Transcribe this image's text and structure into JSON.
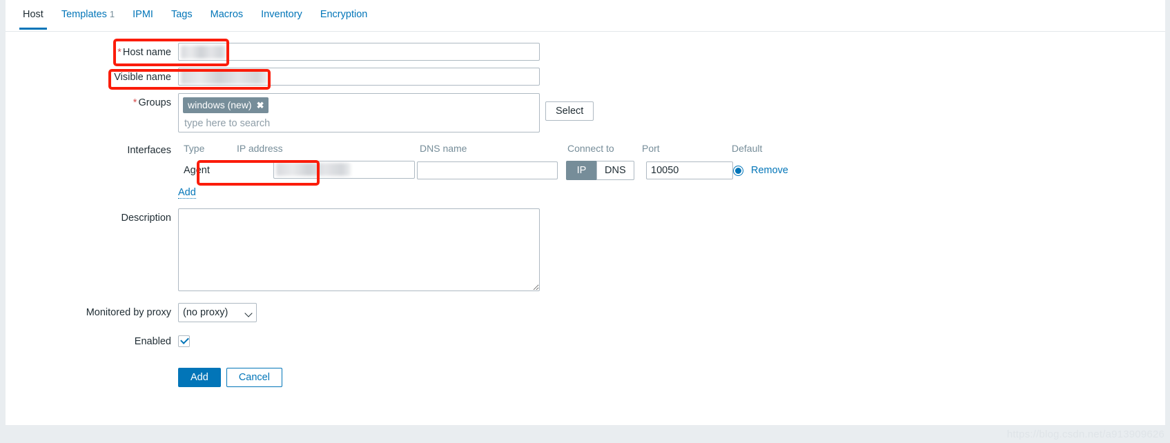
{
  "window": {
    "background_color": "#e9edf0",
    "panel_color": "#ffffff",
    "accent_color": "#0275b8",
    "annotation_color": "#fb1c0a",
    "chip_color": "#768d99",
    "required_color": "#d64e4e"
  },
  "tabs": [
    {
      "label": "Host",
      "count": "",
      "active": true
    },
    {
      "label": "Templates",
      "count": "1",
      "active": false
    },
    {
      "label": "IPMI",
      "count": "",
      "active": false
    },
    {
      "label": "Tags",
      "count": "",
      "active": false
    },
    {
      "label": "Macros",
      "count": "",
      "active": false
    },
    {
      "label": "Inventory",
      "count": "",
      "active": false
    },
    {
      "label": "Encryption",
      "count": "",
      "active": false
    }
  ],
  "form": {
    "host_name": {
      "label": "Host name",
      "required_marker": "*",
      "value": "",
      "redacted": true
    },
    "visible_name": {
      "label": "Visible name",
      "value": "",
      "redacted": true
    },
    "groups": {
      "label": "Groups",
      "required_marker": "*",
      "chips": [
        {
          "label": "windows (new)",
          "remove_icon": "✖"
        }
      ],
      "placeholder": "type here to search",
      "select_button": "Select"
    },
    "interfaces": {
      "label": "Interfaces",
      "columns": [
        "Type",
        "IP address",
        "DNS name",
        "Connect to",
        "Port",
        "Default"
      ],
      "rows": [
        {
          "type": "Agent",
          "ip_address": "",
          "ip_redacted": true,
          "dns_name": "",
          "connect_to_options": [
            "IP",
            "DNS"
          ],
          "connect_to_selected": "IP",
          "port": "10050",
          "default_selected": true,
          "remove_label": "Remove"
        }
      ],
      "add_label": "Add"
    },
    "description": {
      "label": "Description",
      "value": "",
      "placeholder": ""
    },
    "monitored_by_proxy": {
      "label": "Monitored by proxy",
      "selected": "(no proxy)",
      "options": [
        "(no proxy)"
      ]
    },
    "enabled": {
      "label": "Enabled",
      "checked": true
    },
    "buttons": {
      "submit": "Add",
      "cancel": "Cancel"
    }
  },
  "watermark": "https://blog.csdn.net/a913909626"
}
